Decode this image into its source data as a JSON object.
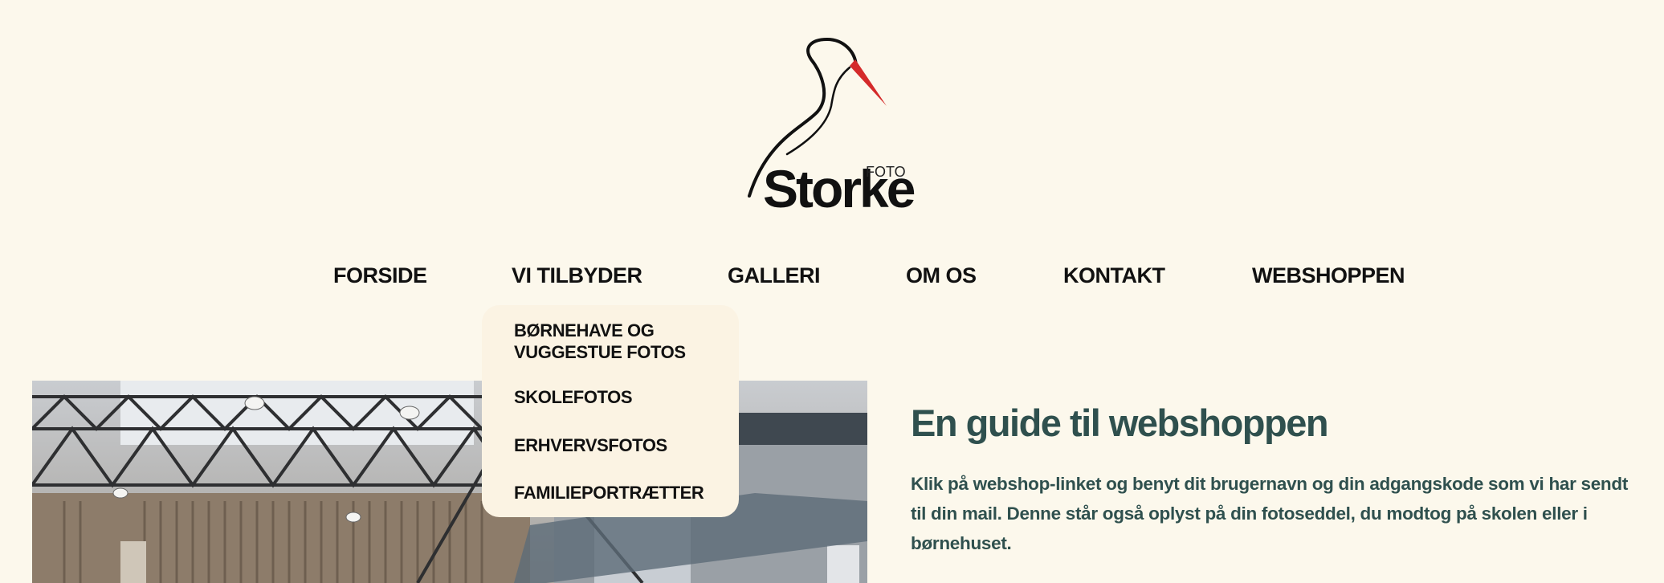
{
  "logo": {
    "word": "Storke",
    "small": "FOTO"
  },
  "nav": {
    "items": [
      "FORSIDE",
      "VI TILBYDER",
      "GALLERI",
      "OM OS",
      "KONTAKT",
      "WEBSHOPPEN"
    ]
  },
  "dropdown": {
    "items": [
      "BØRNEHAVE OG VUGGESTUE FOTOS",
      "SKOLEFOTOS",
      "ERHVERVSFOTOS",
      "FAMILIEPORTRÆTTER"
    ]
  },
  "guide": {
    "title": "En guide til webshoppen",
    "text": "Klik på webshop-linket og benyt dit brugernavn og din adgangskode som vi har sendt til din mail. Denne står også oplyst på din fotoseddel, du modtog på skolen eller i børnehuset."
  },
  "colors": {
    "background": "#fcf8ec",
    "dropdown_bg": "#fbf3e3",
    "heading": "#2f504e",
    "beak": "#d42a2a"
  },
  "icons": {
    "logo_mark": "stork-icon"
  }
}
